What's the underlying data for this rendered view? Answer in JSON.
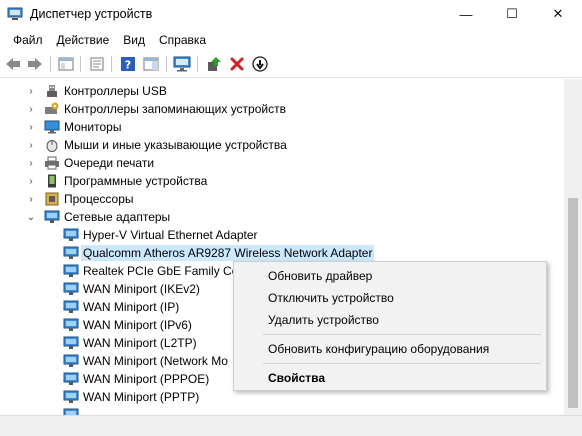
{
  "window": {
    "title": "Диспетчер устройств",
    "minimize": "—",
    "maximize": "☐",
    "close": "✕"
  },
  "menu": [
    "Файл",
    "Действие",
    "Вид",
    "Справка"
  ],
  "colors": {
    "selection": "#cce8ff",
    "network_icon": "#3a8fd8",
    "delete_red": "#d81e1e",
    "add_green": "#2e9a2e"
  },
  "tree": {
    "categories": [
      {
        "label": "Контроллеры USB",
        "icon": "usb-icon",
        "expanded": false
      },
      {
        "label": "Контроллеры запоминающих устройств",
        "icon": "storage-controller-icon",
        "expanded": false
      },
      {
        "label": "Мониторы",
        "icon": "monitor-icon",
        "expanded": false
      },
      {
        "label": "Мыши и иные указывающие устройства",
        "icon": "mouse-icon",
        "expanded": false
      },
      {
        "label": "Очереди печати",
        "icon": "printer-icon",
        "expanded": false
      },
      {
        "label": "Программные устройства",
        "icon": "software-device-icon",
        "expanded": false
      },
      {
        "label": "Процессоры",
        "icon": "processor-icon",
        "expanded": false
      },
      {
        "label": "Сетевые адаптеры",
        "icon": "network-adapter-icon",
        "expanded": true
      }
    ],
    "adapters": [
      {
        "label": "Hyper-V Virtual Ethernet Adapter",
        "selected": false
      },
      {
        "label": "Qualcomm Atheros AR9287 Wireless Network Adapter",
        "selected": true
      },
      {
        "label": "Realtek PCIe GbE Family Con",
        "selected": false
      },
      {
        "label": "WAN Miniport (IKEv2)",
        "selected": false
      },
      {
        "label": "WAN Miniport (IP)",
        "selected": false
      },
      {
        "label": "WAN Miniport (IPv6)",
        "selected": false
      },
      {
        "label": "WAN Miniport (L2TP)",
        "selected": false
      },
      {
        "label": "WAN Miniport (Network Mo",
        "selected": false
      },
      {
        "label": "WAN Miniport (PPPOE)",
        "selected": false
      },
      {
        "label": "WAN Miniport (PPTP)",
        "selected": false
      }
    ]
  },
  "context_menu": {
    "update_driver": "Обновить драйвер",
    "disable_device": "Отключить устройство",
    "uninstall_device": "Удалить устройство",
    "scan_hardware": "Обновить конфигурацию оборудования",
    "properties": "Свойства"
  }
}
